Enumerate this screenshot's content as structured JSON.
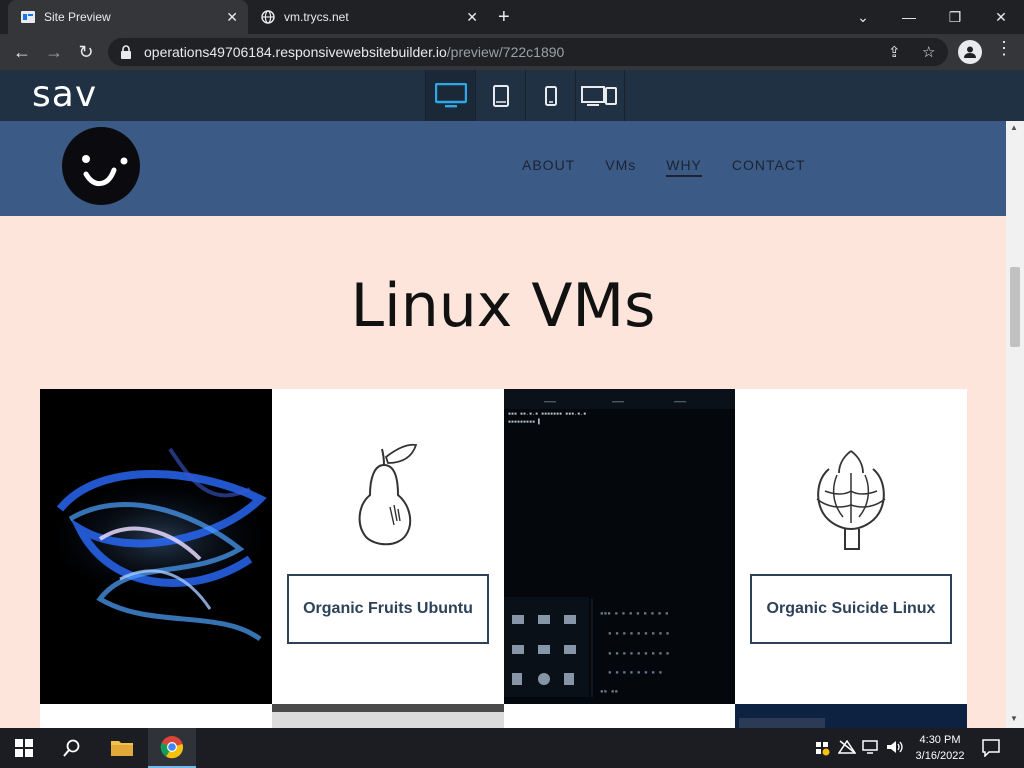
{
  "browser": {
    "tabs": [
      {
        "title": "Site Preview",
        "active": true
      },
      {
        "title": "vm.trycs.net",
        "active": false
      }
    ],
    "address": {
      "host": "operations49706184.responsivewebsitebuilder.io",
      "path": "/preview/722c1890"
    }
  },
  "builder": {
    "logo": "sav",
    "devices": [
      "desktop-icon",
      "tablet-icon",
      "phone-icon",
      "multi-device-icon"
    ],
    "selected_device": "desktop"
  },
  "site": {
    "nav": [
      {
        "label": "ABOUT",
        "selected": false
      },
      {
        "label": "VMs",
        "selected": false
      },
      {
        "label": "WHY",
        "selected": true
      },
      {
        "label": "CONTACT",
        "selected": false
      }
    ],
    "heading": "Linux VMs",
    "cards": [
      {
        "type": "image",
        "desc": "blue-light-swirl"
      },
      {
        "type": "label",
        "label": "Organic Fruits Ubuntu",
        "icon": "pear-icon"
      },
      {
        "type": "image",
        "desc": "terminal-screenshot"
      },
      {
        "type": "label",
        "label": "Organic Suicide Linux",
        "icon": "artichoke-icon"
      }
    ]
  },
  "taskbar": {
    "time": "4:30 PM",
    "date": "3/16/2022"
  },
  "colors": {
    "site_header": "#3c5a86",
    "site_bg": "#fde5dc",
    "builder_bar": "#203144",
    "label_border": "#2d4258"
  }
}
